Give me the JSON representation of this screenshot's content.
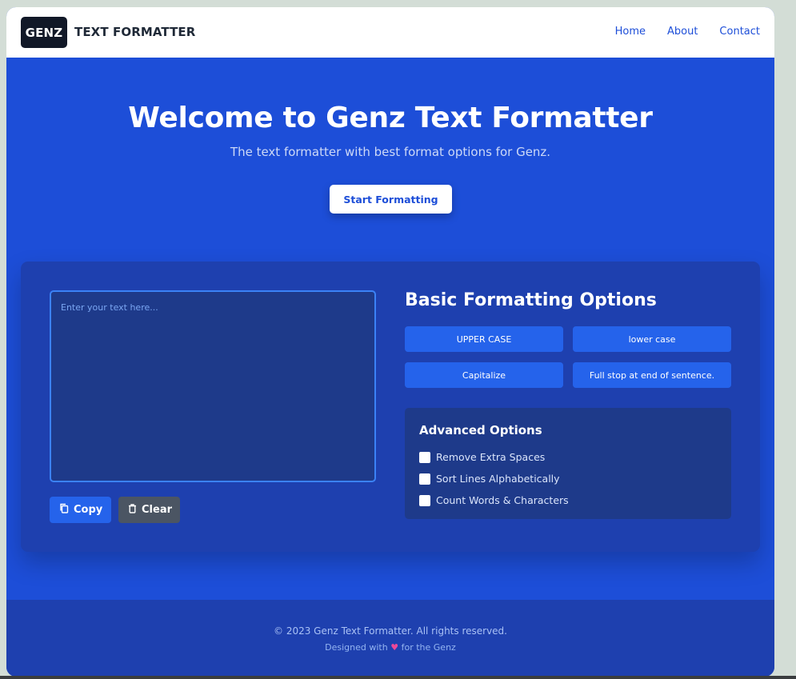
{
  "header": {
    "logo": "GENZ",
    "brand": "TEXT FORMATTER",
    "nav": [
      "Home",
      "About",
      "Contact"
    ]
  },
  "hero": {
    "title": "Welcome to Genz Text Formatter",
    "subtitle": "The text formatter with best format options for Genz.",
    "cta": "Start Formatting"
  },
  "editor": {
    "placeholder": "Enter your text here...",
    "value": "",
    "copy_label": "Copy",
    "clear_label": "Clear"
  },
  "basic": {
    "title": "Basic Formatting Options",
    "buttons": [
      "UPPER CASE",
      "lower case",
      "Capitalize",
      "Full stop at end of sentence."
    ]
  },
  "advanced": {
    "title": "Advanced Options",
    "options": [
      {
        "label": "Remove Extra Spaces",
        "checked": false
      },
      {
        "label": "Sort Lines Alphabetically",
        "checked": false
      },
      {
        "label": "Count Words & Characters",
        "checked": false
      }
    ]
  },
  "footer": {
    "copyright": "© 2023 Genz Text Formatter. All rights reserved.",
    "designed_prefix": "Designed with",
    "heart": "♥",
    "designed_suffix": "for the Genz"
  },
  "colors": {
    "primary": "#1d4ed8",
    "card": "#1e40af",
    "button": "#2563eb",
    "clear": "#4b5563",
    "heart": "#ec4899"
  },
  "icons": {
    "copy": "copy-icon",
    "clear": "trash-icon"
  }
}
